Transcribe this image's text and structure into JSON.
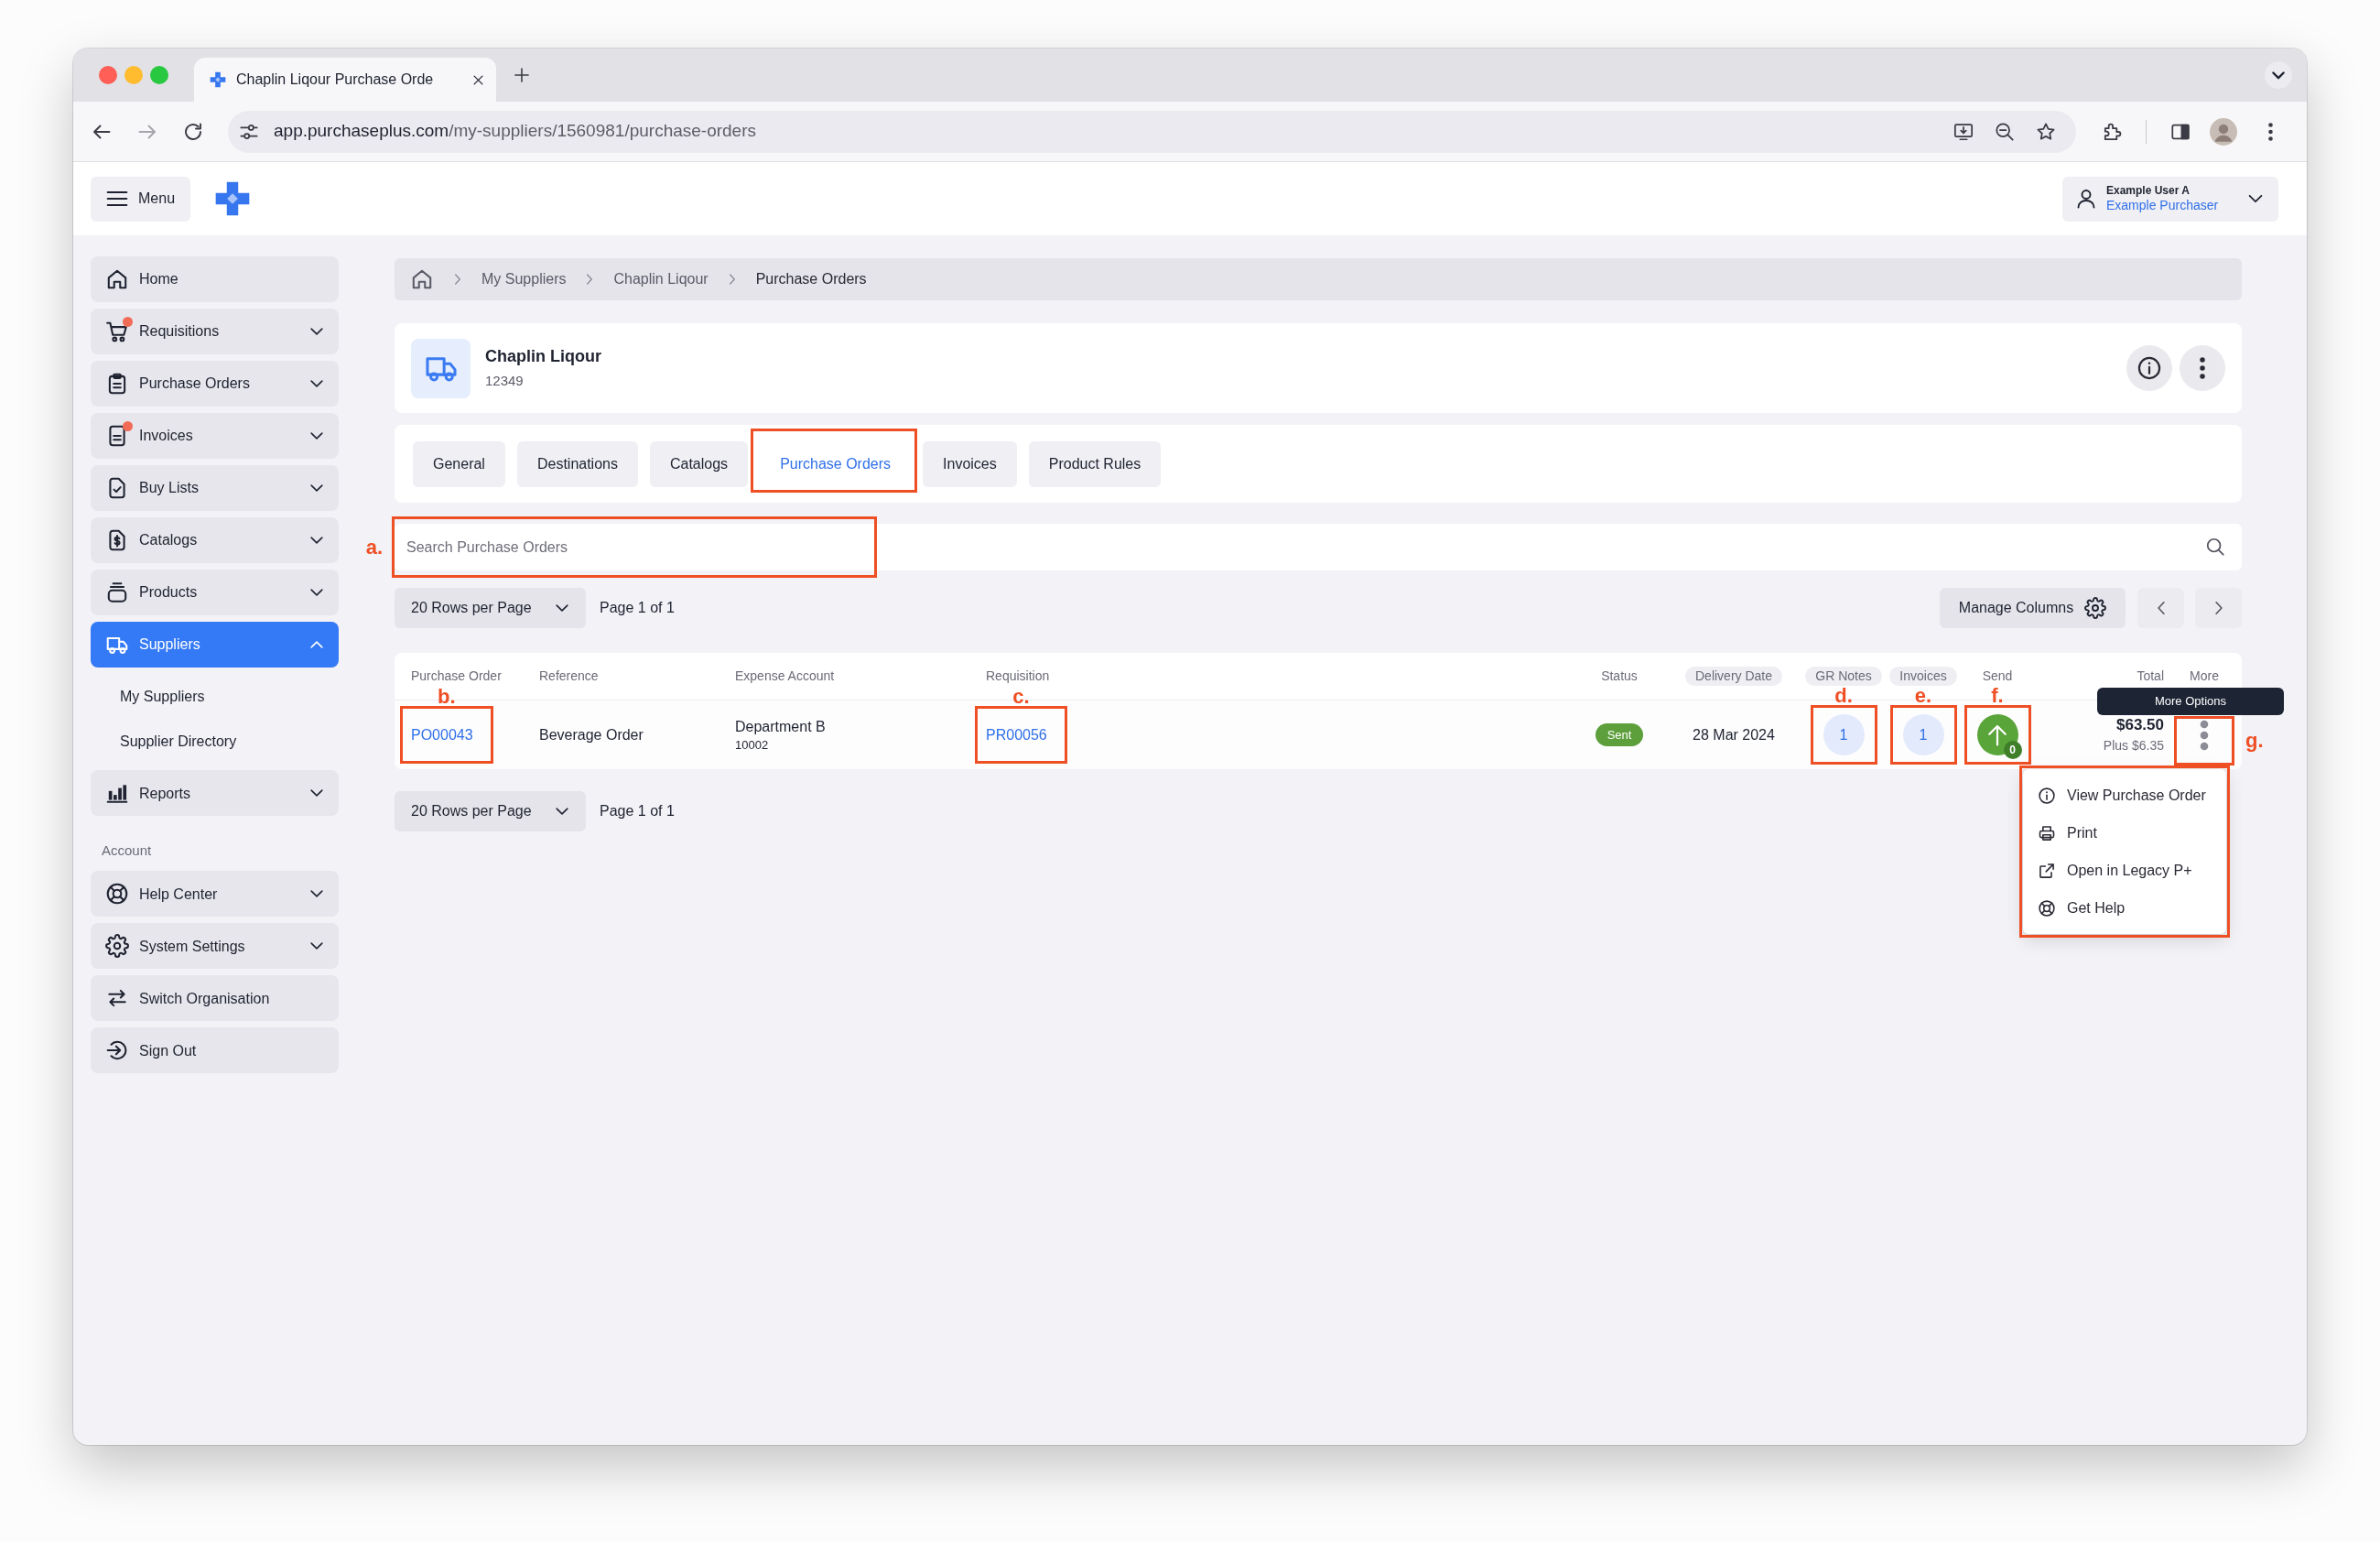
{
  "browser": {
    "tab_title": "Chaplin Liqour Purchase Orde",
    "url_host": "app.purchaseplus.com",
    "url_path": "/my-suppliers/1560981/purchase-orders"
  },
  "app_header": {
    "menu_label": "Menu",
    "user_name": "Example User A",
    "user_role": "Example Purchaser"
  },
  "sidebar": {
    "items": [
      {
        "label": "Home",
        "kind": "home",
        "selected": false,
        "alert": false
      },
      {
        "label": "Requisitions",
        "kind": "cart",
        "selected": false,
        "alert": true,
        "expanded": false
      },
      {
        "label": "Purchase Orders",
        "kind": "clipboard",
        "selected": false,
        "alert": false,
        "expanded": false
      },
      {
        "label": "Invoices",
        "kind": "document",
        "selected": false,
        "alert": true,
        "expanded": false
      },
      {
        "label": "Buy Lists",
        "kind": "checklist",
        "selected": false,
        "alert": false,
        "expanded": false
      },
      {
        "label": "Catalogs",
        "kind": "catalog",
        "selected": false,
        "alert": false,
        "expanded": false
      },
      {
        "label": "Products",
        "kind": "products",
        "selected": false,
        "alert": false,
        "expanded": false
      },
      {
        "label": "Suppliers",
        "kind": "truck",
        "selected": true,
        "alert": false,
        "expanded": true,
        "children": [
          {
            "label": "My Suppliers",
            "selected": false
          },
          {
            "label": "Supplier Directory",
            "selected": false
          }
        ]
      },
      {
        "label": "Reports",
        "kind": "chart",
        "selected": false,
        "alert": false,
        "expanded": false
      }
    ],
    "account_heading": "Account",
    "account_items": [
      {
        "label": "Help Center",
        "kind": "help",
        "selected": false,
        "alert": false,
        "expanded": false
      },
      {
        "label": "System Settings",
        "kind": "settings",
        "selected": false,
        "alert": false,
        "expanded": false
      },
      {
        "label": "Switch Organisation",
        "kind": "switch",
        "selected": false,
        "alert": false
      },
      {
        "label": "Sign Out",
        "kind": "sign_out",
        "selected": false,
        "alert": false
      }
    ]
  },
  "breadcrumb": [
    "My Suppliers",
    "Chaplin Liqour",
    "Purchase Orders"
  ],
  "supplier": {
    "name": "Chaplin Liqour",
    "code": "12349"
  },
  "tabs": [
    {
      "label": "General",
      "selected": false,
      "highlighted": false
    },
    {
      "label": "Destinations",
      "selected": false,
      "highlighted": false
    },
    {
      "label": "Catalogs",
      "selected": false,
      "highlighted": false
    },
    {
      "label": "Purchase Orders",
      "selected": true,
      "highlighted": true
    },
    {
      "label": "Invoices",
      "selected": false,
      "highlighted": false
    },
    {
      "label": "Product Rules",
      "selected": false,
      "highlighted": false
    }
  ],
  "search": {
    "placeholder": "Search Purchase Orders",
    "highlighted": true,
    "callout": "a."
  },
  "toolbar": {
    "rows_per_page": "20 Rows per Page",
    "page_info": "Page 1 of 1",
    "manage_columns": "Manage Columns"
  },
  "table": {
    "columns": [
      {
        "label": "Purchase Order",
        "kind": "plain"
      },
      {
        "label": "Reference",
        "kind": "plain"
      },
      {
        "label": "Expense Account",
        "kind": "plain"
      },
      {
        "label": "Requisition",
        "kind": "plain"
      },
      {
        "label": "Status",
        "kind": "plain"
      },
      {
        "label": "Delivery Date",
        "kind": "pill"
      },
      {
        "label": "GR Notes",
        "kind": "pill"
      },
      {
        "label": "Invoices",
        "kind": "pill"
      },
      {
        "label": "Send",
        "kind": "plain"
      },
      {
        "label": "Total",
        "kind": "plain"
      },
      {
        "label": "More",
        "kind": "plain"
      }
    ],
    "rows": [
      {
        "cells": [
          {
            "kind": "link",
            "text": "PO00043",
            "highlighted": true,
            "callout": "b."
          },
          {
            "kind": "text",
            "text": "Beverage Order",
            "highlighted": false
          },
          {
            "kind": "two_line",
            "text": "Department B",
            "sub": "10002",
            "highlighted": false
          },
          {
            "kind": "link",
            "text": "PR00056",
            "highlighted": true,
            "callout": "c."
          },
          {
            "kind": "badge",
            "text": "Sent",
            "highlighted": false
          },
          {
            "kind": "text",
            "text": "28 Mar 2024",
            "highlighted": false
          },
          {
            "kind": "count",
            "text": "1",
            "highlighted": true,
            "callout": "d."
          },
          {
            "kind": "count",
            "text": "1",
            "highlighted": true,
            "callout": "e."
          },
          {
            "kind": "send",
            "text": "0",
            "highlighted": true,
            "callout": "f."
          },
          {
            "kind": "amount",
            "text": "$63.50",
            "sub": "Plus $6.35",
            "highlighted": false
          },
          {
            "kind": "more",
            "highlighted": true,
            "callout": "g."
          }
        ]
      }
    ]
  },
  "tooltip": {
    "text": "More Options"
  },
  "row_menu": {
    "highlighted": true,
    "items": [
      {
        "label": "View Purchase Order",
        "kind": "view"
      },
      {
        "label": "Print",
        "kind": "print"
      },
      {
        "label": "Open in Legacy P+",
        "kind": "open_external"
      },
      {
        "label": "Get Help",
        "kind": "help"
      }
    ]
  },
  "bottom_toolbar": {
    "rows_per_page": "20 Rows per Page",
    "page_info": "Page 1 of 1"
  }
}
